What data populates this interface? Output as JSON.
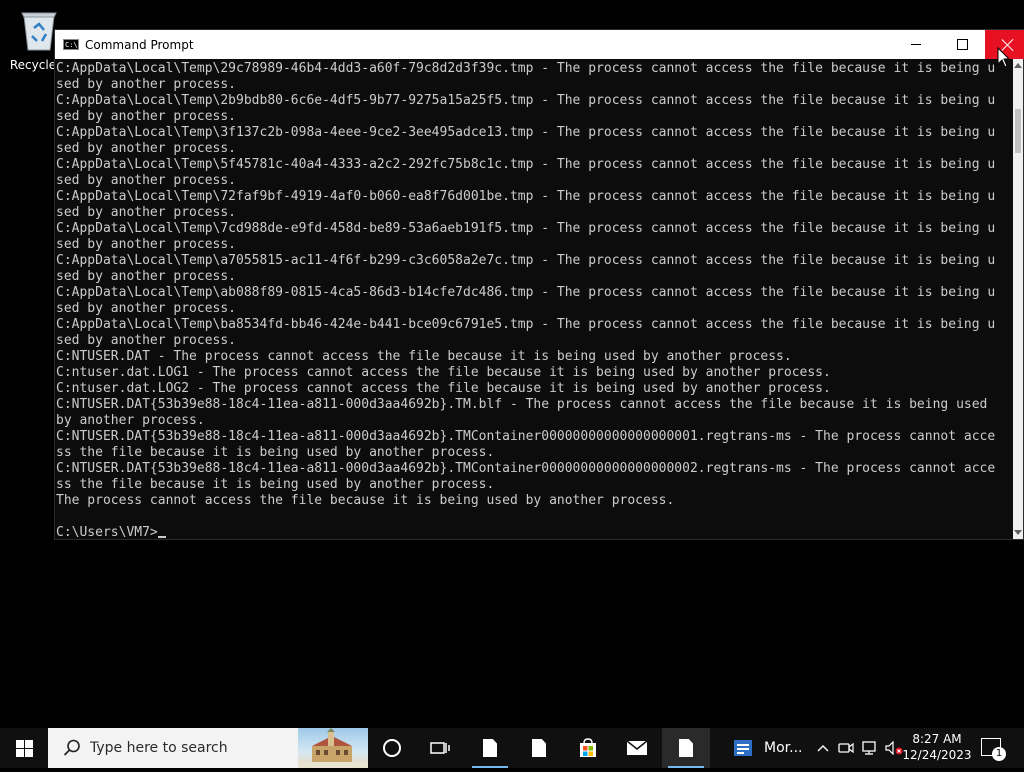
{
  "desktop": {
    "recycle_bin_label": "Recycle B"
  },
  "window": {
    "title": "Command Prompt",
    "icon_glyph": "C:\\",
    "controls": [
      "minimize-icon",
      "maximize-icon",
      "close-icon"
    ]
  },
  "console": {
    "lines": [
      "C:AppData\\Local\\Temp\\29c78989-46b4-4dd3-a60f-79c8d2d3f39c.tmp - The process cannot access the file because it is being u",
      "sed by another process.",
      "C:AppData\\Local\\Temp\\2b9bdb80-6c6e-4df5-9b77-9275a15a25f5.tmp - The process cannot access the file because it is being u",
      "sed by another process.",
      "C:AppData\\Local\\Temp\\3f137c2b-098a-4eee-9ce2-3ee495adce13.tmp - The process cannot access the file because it is being u",
      "sed by another process.",
      "C:AppData\\Local\\Temp\\5f45781c-40a4-4333-a2c2-292fc75b8c1c.tmp - The process cannot access the file because it is being u",
      "sed by another process.",
      "C:AppData\\Local\\Temp\\72faf9bf-4919-4af0-b060-ea8f76d001be.tmp - The process cannot access the file because it is being u",
      "sed by another process.",
      "C:AppData\\Local\\Temp\\7cd988de-e9fd-458d-be89-53a6aeb191f5.tmp - The process cannot access the file because it is being u",
      "sed by another process.",
      "C:AppData\\Local\\Temp\\a7055815-ac11-4f6f-b299-c3c6058a2e7c.tmp - The process cannot access the file because it is being u",
      "sed by another process.",
      "C:AppData\\Local\\Temp\\ab088f89-0815-4ca5-86d3-b14cfe7dc486.tmp - The process cannot access the file because it is being u",
      "sed by another process.",
      "C:AppData\\Local\\Temp\\ba8534fd-bb46-424e-b441-bce09c6791e5.tmp - The process cannot access the file because it is being u",
      "sed by another process.",
      "C:NTUSER.DAT - The process cannot access the file because it is being used by another process.",
      "C:ntuser.dat.LOG1 - The process cannot access the file because it is being used by another process.",
      "C:ntuser.dat.LOG2 - The process cannot access the file because it is being used by another process.",
      "C:NTUSER.DAT{53b39e88-18c4-11ea-a811-000d3aa4692b}.TM.blf - The process cannot access the file because it is being used",
      "by another process.",
      "C:NTUSER.DAT{53b39e88-18c4-11ea-a811-000d3aa4692b}.TMContainer00000000000000000001.regtrans-ms - The process cannot acce",
      "ss the file because it is being used by another process.",
      "C:NTUSER.DAT{53b39e88-18c4-11ea-a811-000d3aa4692b}.TMContainer00000000000000000002.regtrans-ms - The process cannot acce",
      "ss the file because it is being used by another process.",
      "The process cannot access the file because it is being used by another process.",
      ""
    ],
    "prompt": "C:\\Users\\VM7>"
  },
  "taskbar": {
    "search_placeholder": "Type here to search",
    "more_label": "Mor...",
    "clock_time": "8:27 AM",
    "clock_date": "12/24/2023",
    "notification_count": "1",
    "accent": "#76b9ed"
  }
}
